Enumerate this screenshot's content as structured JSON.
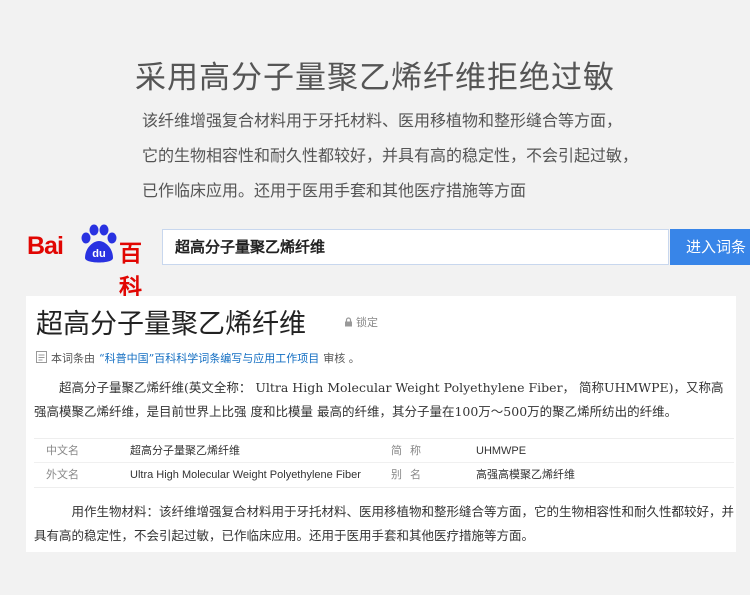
{
  "hero": {
    "title": "采用高分子量聚乙烯纤维拒绝过敏",
    "lines": [
      "该纤维增强复合材料用于牙托材料、医用移植物和整形缝合等方面，",
      "它的生物相容性和耐久性都较好，并具有高的稳定性，不会引起过敏，",
      "已作临床应用。还用于医用手套和其他医疗措施等方面"
    ]
  },
  "logo": {
    "bai": "Bai",
    "paw_text": "du",
    "baike": "百科"
  },
  "search": {
    "value": "超高分子量聚乙烯纤维",
    "button": "进入词条"
  },
  "entry": {
    "title": "超高分子量聚乙烯纤维",
    "lock_label": "锁定",
    "review_prefix": "本词条由",
    "review_link": "“科普中国”百科科学词条编写与应用工作项目",
    "review_suffix": "审核 。",
    "summary": "超高分子量聚乙烯纤维(英文全称：  Ultra High Molecular Weight Polyethylene Fiber，  简称UHMWPE)，又称高强高模聚乙烯纤维，是目前世界上比强 度和比模量 最高的纤维，其分子量在100万～500万的聚乙烯所纺出的纤维。",
    "basic_info": [
      {
        "label1": "中文名",
        "value1": "超高分子量聚乙烯纤维",
        "label2": "简称",
        "value2": "UHMWPE"
      },
      {
        "label1": "外文名",
        "value1": "Ultra High Molecular Weight Polyethylene Fiber",
        "label2": "别名",
        "value2": "高强高模聚乙烯纤维"
      }
    ],
    "paragraph": "用作生物材料：该纤维增强复合材料用于牙托材料、医用移植物和整形缝合等方面，它的生物相容性和耐久性都较好，并具有高的稳定性，不会引起过敏，已作临床应用。还用于医用手套和其他医疗措施等方面。"
  },
  "colors": {
    "brand_red": "#e10602",
    "paw_blue": "#2932e1",
    "button_blue": "#3885e8",
    "link_blue": "#136ec2"
  },
  "icons": {
    "lock": "lock-icon",
    "doc": "document-icon",
    "paw": "baidu-paw-icon"
  }
}
